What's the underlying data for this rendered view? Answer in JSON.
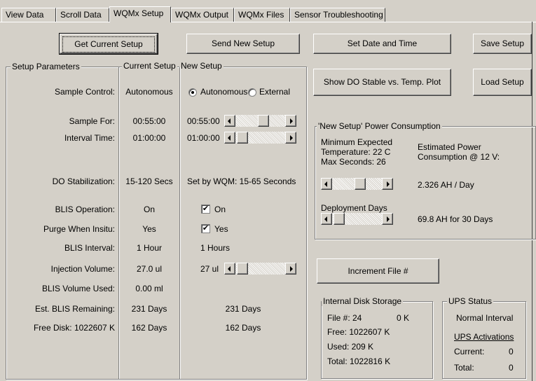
{
  "tabs": [
    "View Data",
    "Scroll Data",
    "WQMx Setup",
    "WQMx Output",
    "WQMx Files",
    "Sensor Troubleshooting"
  ],
  "buttons": {
    "get_current_setup": "Get Current Setup",
    "send_new_setup": "Send New Setup",
    "set_date_time": "Set Date and Time",
    "save_setup": "Save Setup",
    "show_do_plot": "Show DO Stable vs. Temp. Plot",
    "load_setup": "Load Setup",
    "increment_file": "Increment File #"
  },
  "setup": {
    "group_title": "Setup Parameters",
    "col_current": "Current Setup",
    "col_new": "New Setup",
    "rows": [
      {
        "param": "Sample Control:",
        "current": "Autonomous"
      },
      {
        "param": "Sample For:",
        "current": "00:55:00",
        "new": "00:55:00"
      },
      {
        "param": "Interval Time:",
        "current": "01:00:00",
        "new": "01:00:00"
      },
      {
        "param": "DO Stabilization:",
        "current": "15-120 Secs",
        "new": "Set by WQM: 15-65 Seconds"
      },
      {
        "param": "BLIS Operation:",
        "current": "On",
        "new": "On"
      },
      {
        "param": "Purge When Insitu:",
        "current": "Yes",
        "new": "Yes"
      },
      {
        "param": "BLIS Interval:",
        "current": "1 Hour",
        "new": "1 Hours"
      },
      {
        "param": "Injection Volume:",
        "current": "27.0 ul",
        "new": "27 ul"
      },
      {
        "param": "BLIS Volume Used:",
        "current": "0.00 ml"
      },
      {
        "param": "Est. BLIS Remaining:",
        "current": "231 Days",
        "new": "231 Days"
      },
      {
        "param": "Free Disk: 1022607 K",
        "current": "162 Days",
        "new": "162 Days"
      }
    ],
    "radio_autonomous": "Autonomous",
    "radio_external": "External",
    "sample_control_selected": "Autonomous",
    "blis_operation_checked": true,
    "purge_checked": true,
    "check_mark": "✔"
  },
  "power": {
    "group_title": "'New Setup' Power Consumption",
    "min_temp_line1": "Minimum Expected",
    "min_temp_line2": "Temperature: 22 C",
    "min_temp_line3": "Max Seconds: 26",
    "est_power_line1": "Estimated  Power",
    "est_power_line2": "Consumption @ 12 V:",
    "ah_per_day": "2.326 AH / Day",
    "deployment_label": "Deployment Days",
    "ah_total": "69.8 AH for 30 Days"
  },
  "disk": {
    "group_title": "Internal Disk Storage",
    "file_label": "File #:  24",
    "file_size": "0 K",
    "free": "Free:  1022607 K",
    "used": "Used:  209 K",
    "total": "Total:  1022816 K"
  },
  "ups": {
    "group_title": "UPS Status",
    "status": "Normal Interval",
    "activations_label": "UPS Activations",
    "current_label": "Current:",
    "current_value": "0",
    "total_label": "Total:",
    "total_value": "0"
  }
}
